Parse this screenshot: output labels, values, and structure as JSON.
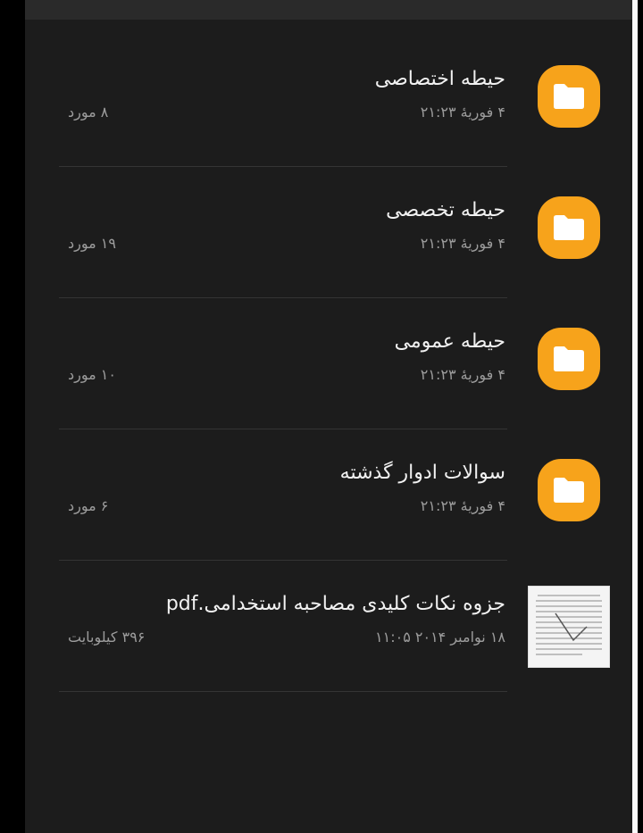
{
  "items": [
    {
      "type": "folder",
      "icon": "folder-icon",
      "title": "حیطه اختصاصی",
      "date": "۴ فوریهٔ ۲۱:۲۳",
      "count": "۸ مورد"
    },
    {
      "type": "folder",
      "icon": "folder-icon",
      "title": "حیطه تخصصی",
      "date": "۴ فوریهٔ ۲۱:۲۳",
      "count": "۱۹ مورد"
    },
    {
      "type": "folder",
      "icon": "folder-icon",
      "title": "حیطه عمومی",
      "date": "۴ فوریهٔ ۲۱:۲۳",
      "count": "۱۰ مورد"
    },
    {
      "type": "folder",
      "icon": "folder-icon",
      "title": "سوالات ادوار گذشته",
      "date": "۴ فوریهٔ ۲۱:۲۳",
      "count": "۶ مورد"
    },
    {
      "type": "file",
      "icon": "pdf-document-thumbnail-icon",
      "title": "جزوه نکات کلیدی مصاحبه استخدامی.pdf",
      "date": "۱۸ نوامبر ۲۰۱۴ ۱۱:۰۵",
      "size": "۳۹۶ کیلوبایت"
    }
  ],
  "colors": {
    "background": "#1c1c1c",
    "folder_accent": "#f7a31b",
    "title_text": "#f1f1f1",
    "secondary_text": "#9c9c9c"
  }
}
